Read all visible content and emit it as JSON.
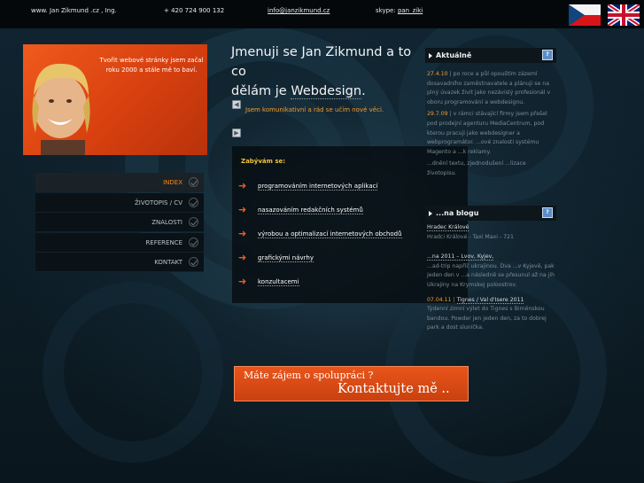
{
  "topbar": {
    "site": "www. Jan Zikmund .cz , Ing.",
    "phone": "+ 420 724 900 132",
    "email": "info@janzikmund.cz",
    "skype_label": "skype:",
    "skype_name": "pan_ziki"
  },
  "portrait": {
    "caption": "Tvořit webové stránky jsem začal roku 2000 a stále mě to baví."
  },
  "menu": [
    {
      "label": "INDEX",
      "active": true
    },
    {
      "label": "ŽIVOTOPIS / CV",
      "active": false
    },
    {
      "label": "ZNALOSTI",
      "active": false
    },
    {
      "label": "REFERENCE",
      "active": false
    },
    {
      "label": "KONTAKT",
      "active": false
    }
  ],
  "headline": {
    "line1": "Jmenuji se Jan Zikmund a to co",
    "line2a": "dělám je ",
    "line2b": "Webdesign",
    "line2c": "."
  },
  "intro": "Jsem komunikativní a rád se učím nové věci.",
  "services": {
    "heading": "Zabývám se:",
    "items": [
      "programováním internetových aplikací",
      "nasazováním redakčních systémů",
      "výrobou a optimalizací internetových obchodů",
      "grafickými návrhy",
      "konzultacemi"
    ]
  },
  "news": {
    "heading": "Aktuálně",
    "entries": [
      {
        "date": "27.4.10",
        "text": " | po roce a půl opouštím zázemí dosavadního zaměstnavatele a plánuji se na plný úvazek živit jako nezávislý profesionál v oboru programování a webdesignu."
      },
      {
        "date": "29.7.09",
        "text": " | v rámci stávající firmy jsem přešel pod prodejní agenturu MediaCentrum, pod kterou pracuji jako webdesigner a webprogramátor. ...ové znalosti systému Magento a ...k reklamy."
      },
      {
        "date": "",
        "text": "...dnění textu, zjednodušení ...lizace životopisu."
      }
    ]
  },
  "blog": {
    "heading": "...na blogu",
    "entries": [
      {
        "date": "",
        "title": "Hradec Králové",
        "text": "Hradci Králové - Taxi Maxi - 721"
      },
      {
        "date": "",
        "title": "...na 2011 – Lvov, Kyjev,",
        "text": "...ad-trip napříč ukrajinou. Dva ...v Kyjevě, pak jeden den v ...a následně se přesunul až na jih Ukrajiny na Krymskej poloostrov."
      },
      {
        "date": "07.04.11",
        "title": "Tignes / Val d'Isere 2011",
        "text": "Týdenní zimní výlet do Tignes s Biměnskou bandou. Powder jen jeden den, za to dobrej park a dost sluníčka."
      }
    ]
  },
  "banner": {
    "line1": "Máte zájem o spolupráci ?",
    "line2": "Kontaktujte mě .."
  },
  "colors": {
    "accent_orange": "#f39a2b",
    "banner_orange": "#e9541b",
    "background": "#0c1a22"
  }
}
